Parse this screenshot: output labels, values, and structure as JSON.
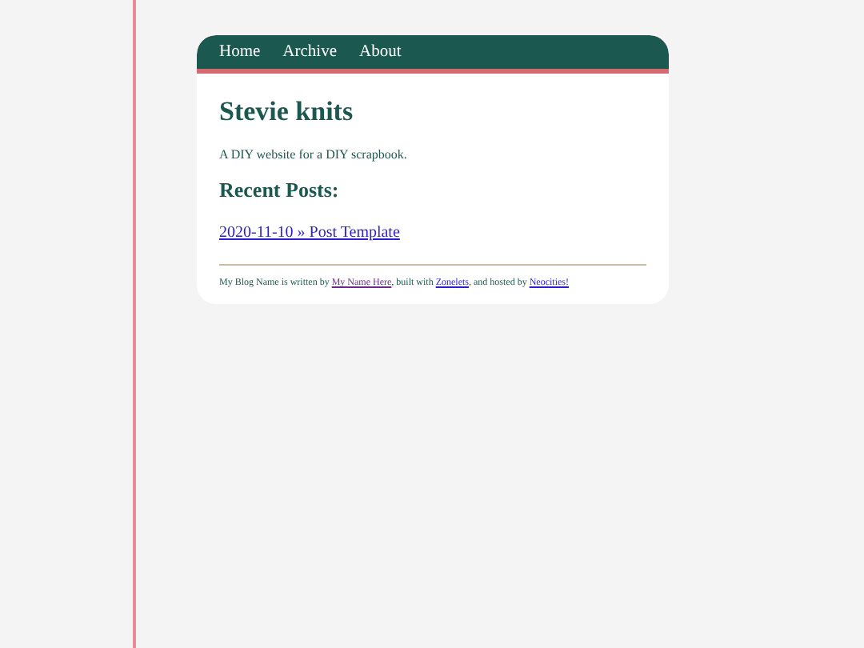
{
  "nav": [
    {
      "label": "Home"
    },
    {
      "label": "Archive"
    },
    {
      "label": "About"
    }
  ],
  "title": "Stevie knits",
  "tagline": "A DIY website for a DIY scrapbook.",
  "recent_heading": "Recent Posts:",
  "posts": [
    {
      "label": "2020-11-10 » Post Template"
    }
  ],
  "footer": [
    {
      "kind": "text",
      "text": "My Blog Name is written by "
    },
    {
      "kind": "link",
      "text": "My Name Here",
      "visited": true
    },
    {
      "kind": "text",
      "text": ", built with "
    },
    {
      "kind": "link",
      "text": "Zonelets",
      "visited": false
    },
    {
      "kind": "text",
      "text": ", and hosted by "
    },
    {
      "kind": "link",
      "text": "Neocities!",
      "visited": false
    }
  ]
}
